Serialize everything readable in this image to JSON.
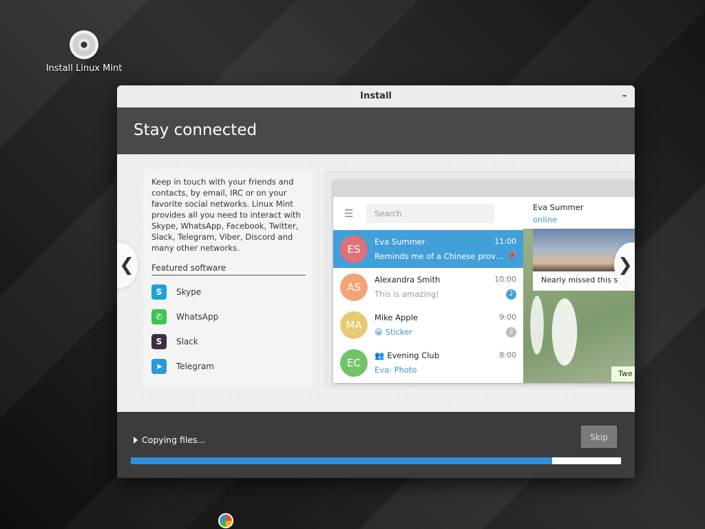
{
  "desktop": {
    "icon_label": "Install Linux Mint"
  },
  "window": {
    "title": "Install",
    "minimize_label": "–"
  },
  "header": {
    "title": "Stay connected"
  },
  "slide": {
    "description": "Keep in touch with your friends and contacts, by email, IRC or on your favorite social networks. Linux Mint provides all you need to interact with Skype, WhatsApp, Facebook, Twitter, Slack, Telegram, Viber, Discord and many other networks.",
    "featured_title": "Featured software",
    "apps": [
      {
        "name": "Skype",
        "icon": "skype-icon",
        "color": "#1fa0dc",
        "glyph": "S"
      },
      {
        "name": "WhatsApp",
        "icon": "whatsapp-icon",
        "color": "#3fc351",
        "glyph": "✆"
      },
      {
        "name": "Slack",
        "icon": "slack-icon",
        "color": "#3e2d43",
        "glyph": "S"
      },
      {
        "name": "Telegram",
        "icon": "telegram-icon",
        "color": "#2b9ad8",
        "glyph": "➤"
      }
    ],
    "nav_prev": "❮",
    "nav_next": "❯"
  },
  "telegram": {
    "search_placeholder": "Search",
    "chats": [
      {
        "initials": "ES",
        "name": "Eva Summer",
        "time": "11:00",
        "preview": "Reminds me of a Chinese prover…",
        "avatar_color": "#e0707a",
        "active": true,
        "badge": "",
        "pin": "📌"
      },
      {
        "initials": "AS",
        "name": "Alexandra Smith",
        "time": "10:00",
        "preview": "This is amazing!",
        "avatar_color": "#f3a374",
        "active": false,
        "badge": "2",
        "badge_color": "#419fd9"
      },
      {
        "initials": "MA",
        "name": "Mike Apple",
        "time": "9:00",
        "preview": "😀 Sticker",
        "avatar_color": "#e8c873",
        "active": false,
        "badge": "2",
        "badge_color": "#bbbbbb"
      },
      {
        "initials": "EC",
        "name": "Evening Club",
        "time": "8:00",
        "preview": "Eva: Photo",
        "avatar_color": "#72c36a",
        "active": false,
        "badge": "",
        "group_icon": "👥"
      }
    ],
    "contact_name": "Eva Summer",
    "contact_status": "online",
    "message_text": "Nearly missed this s",
    "bubble_text": "Twe"
  },
  "footer": {
    "status_text": "Copying files...",
    "skip_label": "Skip",
    "progress_fraction": 0.86
  },
  "colors": {
    "accent": "#2f8fdc",
    "header_bg": "#494949",
    "telegram_active": "#419fd9"
  }
}
